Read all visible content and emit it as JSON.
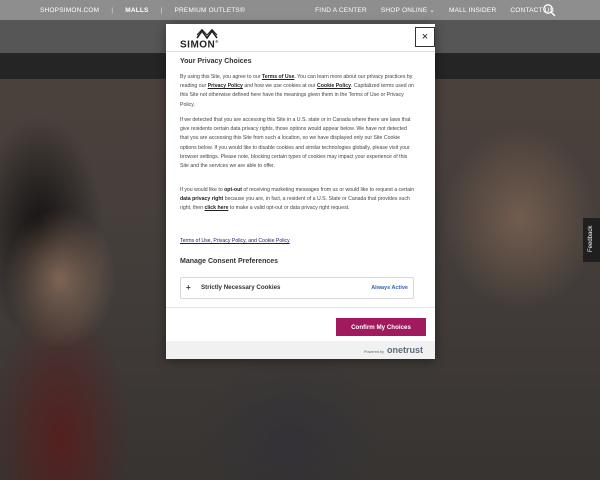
{
  "topnav": {
    "left": [
      "SHOPSIMON.COM",
      "MALLS",
      "PREMIUM OUTLETS®"
    ],
    "separator": "|",
    "right": [
      "FIND A CENTER",
      "SHOP ONLINE ⌄",
      "MALL INSIDER",
      "CONTACT US"
    ]
  },
  "feedback": "Feedback",
  "modal": {
    "logo_text": "SIMON",
    "close": "×",
    "title": "Your Privacy Choices",
    "p1": {
      "a": "By using this Site, you agree to our ",
      "terms": "Terms of Use",
      "b": ". You can learn more about our privacy practices by reading our ",
      "privacy": "Privacy Policy",
      "c": " and how we use cookies at our ",
      "cookie": "Cookie Policy",
      "d": ". Capitalized terms used on this Site not otherwise defined here have the meanings given them in the Terms of Use or Privacy Policy."
    },
    "p2": "If we detected that you are accessing this Site in a U.S. state or in Canada where there are laws that give residents certain data privacy rights, those options would appear below. We have not detected that you are accessing this Site from such a location, so we have displayed only our Site Cookie options below. If you would like to disable cookies and similar technologies globally, please visit your browser settings. Please note, blocking certain types of cookies may impact your experience of this Site and the services we are able to offer.",
    "p3": {
      "a": "If you would like to ",
      "optout": "opt-out",
      "b": " of receiving marketing messages from us or would like to request a certain ",
      "dpr": "data privacy right",
      "c": " because you are, in fact, a resident of a U.S. State or Canada that provides such right, then ",
      "click": "click here",
      "d": " to make a valid opt-out or data privacy right request."
    },
    "legal_link": "Terms of Use, Privacy Policy, and Cookie Policy",
    "manage_title": "Manage Consent Preferences",
    "consent": {
      "plus": "+",
      "label": "Strictly Necessary Cookies",
      "status": "Always Active"
    },
    "confirm": "Confirm My Choices",
    "powered_by": "Powered by",
    "onetrust": "onetrust"
  },
  "colors": {
    "confirm": "#a1195f",
    "status": "#3860be"
  }
}
